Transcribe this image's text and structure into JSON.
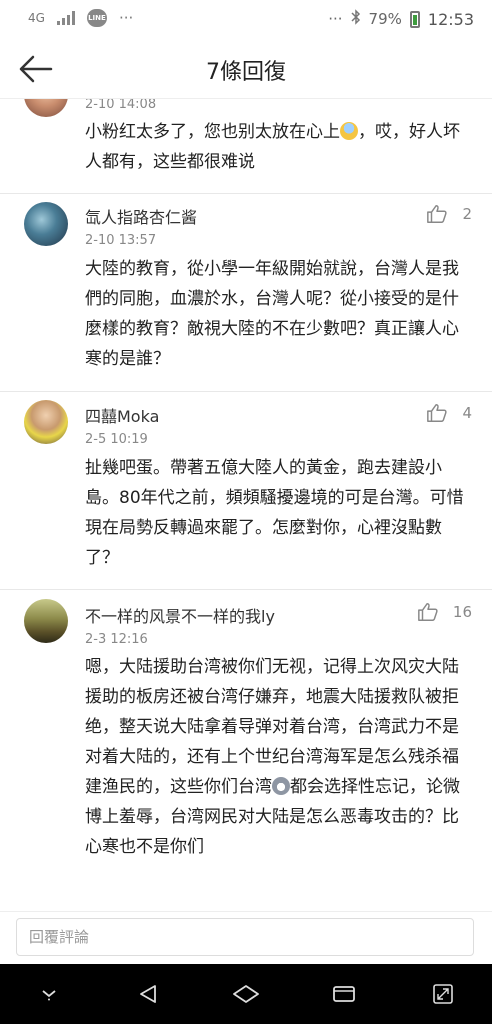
{
  "status_bar": {
    "network": "4G",
    "app_badge": "LINE",
    "more": "···",
    "more_right": "···",
    "battery": "79%",
    "time": "12:53"
  },
  "header": {
    "title": "7條回復"
  },
  "comments": [
    {
      "author": "",
      "time": "2-10 14:08",
      "body_before_emoji": "小粉红太多了，您也别太放在心上",
      "body_after_emoji": "，哎，好人坏人都有，这些都很难说",
      "likes": ""
    },
    {
      "author": "氙人指路杏仁酱",
      "time": "2-10 13:57",
      "body": "大陸的教育，從小學一年級開始就說，台灣人是我們的同胞，血濃於水，台灣人呢？從小接受的是什麼樣的教育？敵視大陸的不在少數吧？真正讓人心寒的是誰？",
      "likes": "2"
    },
    {
      "author": "四囍Moka",
      "time": "2-5 10:19",
      "body": "扯幾吧蛋。帶著五億大陸人的黃金，跑去建設小島。80年代之前，頻頻騷擾邊境的可是台灣。可惜現在局勢反轉過來罷了。怎麼對你，心裡沒點數了？",
      "likes": "4"
    },
    {
      "author": "不一样的风景不一样的我ly",
      "time": "2-3 12:16",
      "body_before_emoji": "嗯，大陆援助台湾被你们无视，记得上次风灾大陆援助的板房还被台湾仔嫌弃，地震大陆援救队被拒绝，整天说大陆拿着导弹对着台湾，台湾武力不是对着大陆的，还有上个世纪台湾海军是怎么残杀福建渔民的，这些你们台湾",
      "body_after_emoji": "都会选择性忘记，论微博上羞辱，台湾网民对大陆是怎么恶毒攻击的？比心寒也不是你们",
      "likes": "16"
    }
  ],
  "reply_input": {
    "placeholder": "回覆評論"
  },
  "colors": {
    "text": "#222222",
    "meta": "#888888",
    "navbar": "#000000"
  },
  "icons": [
    "back-arrow-icon",
    "thumbs-up-icon",
    "nav-down-icon",
    "nav-back-icon",
    "nav-home-icon",
    "nav-recents-icon",
    "nav-expand-icon"
  ]
}
